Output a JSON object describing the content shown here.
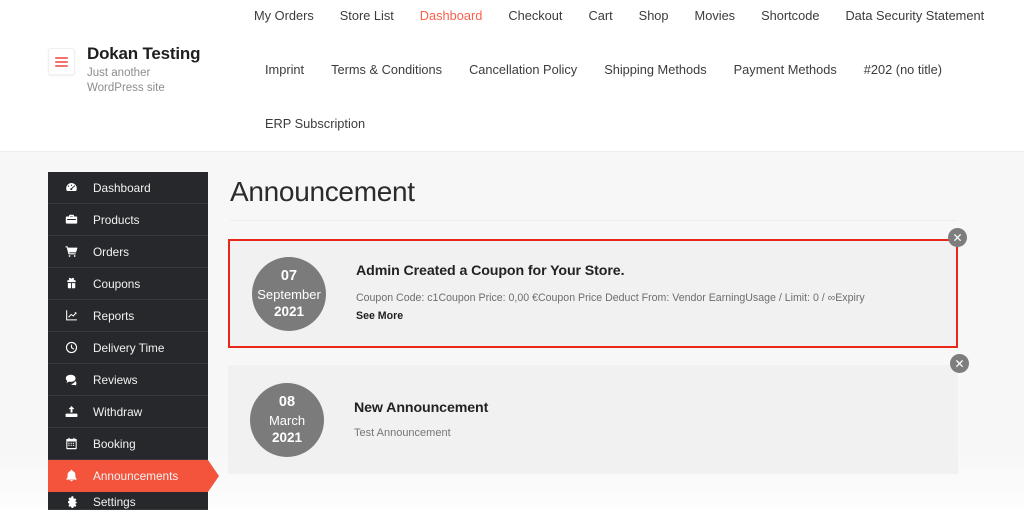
{
  "site": {
    "title": "Dokan Testing",
    "tagline": "Just another WordPress site",
    "menu_toggle_icon": "hamburger-icon"
  },
  "top_nav": {
    "row1": [
      {
        "label": "My Orders",
        "active": false
      },
      {
        "label": "Store List",
        "active": false
      },
      {
        "label": "Dashboard",
        "active": true
      },
      {
        "label": "Checkout",
        "active": false
      },
      {
        "label": "Cart",
        "active": false
      },
      {
        "label": "Shop",
        "active": false
      },
      {
        "label": "Movies",
        "active": false
      },
      {
        "label": "Shortcode",
        "active": false
      },
      {
        "label": "Data Security Statement",
        "active": false
      }
    ],
    "row2": [
      {
        "label": "Imprint",
        "active": false
      },
      {
        "label": "Terms & Conditions",
        "active": false
      },
      {
        "label": "Cancellation Policy",
        "active": false
      },
      {
        "label": "Shipping Methods",
        "active": false
      },
      {
        "label": "Payment Methods",
        "active": false
      },
      {
        "label": "#202 (no title)",
        "active": false
      }
    ],
    "row3": [
      {
        "label": "ERP Subscription",
        "active": false
      }
    ],
    "active_color": "#fb5f4c"
  },
  "sidebar": {
    "active_color": "#f4543c",
    "background": "#26282b",
    "items": [
      {
        "label": "Dashboard",
        "icon": "speedometer-icon",
        "active": false
      },
      {
        "label": "Products",
        "icon": "briefcase-icon",
        "active": false
      },
      {
        "label": "Orders",
        "icon": "cart-icon",
        "active": false
      },
      {
        "label": "Coupons",
        "icon": "gift-icon",
        "active": false
      },
      {
        "label": "Reports",
        "icon": "chart-line-icon",
        "active": false
      },
      {
        "label": "Delivery Time",
        "icon": "clock-icon",
        "active": false
      },
      {
        "label": "Reviews",
        "icon": "comment-icon",
        "active": false
      },
      {
        "label": "Withdraw",
        "icon": "upload-icon",
        "active": false
      },
      {
        "label": "Booking",
        "icon": "calendar-icon",
        "active": false
      },
      {
        "label": "Announcements",
        "icon": "bell-icon",
        "active": true
      },
      {
        "label": "Settings",
        "icon": "gear-icon",
        "active": false
      }
    ]
  },
  "main": {
    "page_title": "Announcement",
    "announcements": [
      {
        "day": "07",
        "month": "September",
        "year": "2021",
        "title": "Admin Created a Coupon for Your Store.",
        "description": "Coupon Code: c1Coupon Price: 0,00 €Coupon Price Deduct From: Vendor EarningUsage / Limit: 0 / ∞Expiry",
        "see_more": "See More",
        "highlighted": true,
        "highlight_color": "#e8271a",
        "close_icon": "close-icon"
      },
      {
        "day": "08",
        "month": "March",
        "year": "2021",
        "title": "New Announcement",
        "description": "Test Announcement",
        "see_more": "",
        "highlighted": false,
        "close_icon": "close-icon"
      }
    ]
  }
}
